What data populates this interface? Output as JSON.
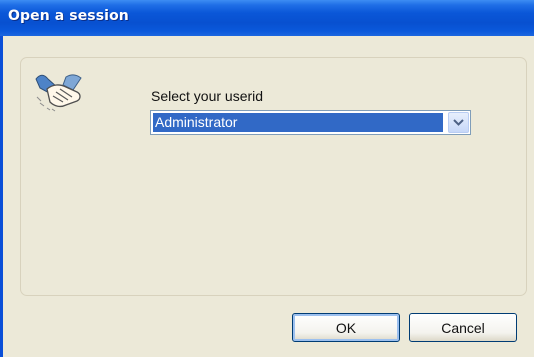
{
  "window": {
    "title": "Open a session"
  },
  "form": {
    "userid_label": "Select your userid",
    "userid_selected": "Administrator"
  },
  "buttons": {
    "ok_label": "OK",
    "cancel_label": "Cancel"
  },
  "icons": {
    "session": "handshake-icon",
    "dropdown": "chevron-down-icon"
  },
  "colors": {
    "titlebar": "#0a57d8",
    "selection": "#3169c6",
    "dialog_background": "#ece9d8"
  }
}
